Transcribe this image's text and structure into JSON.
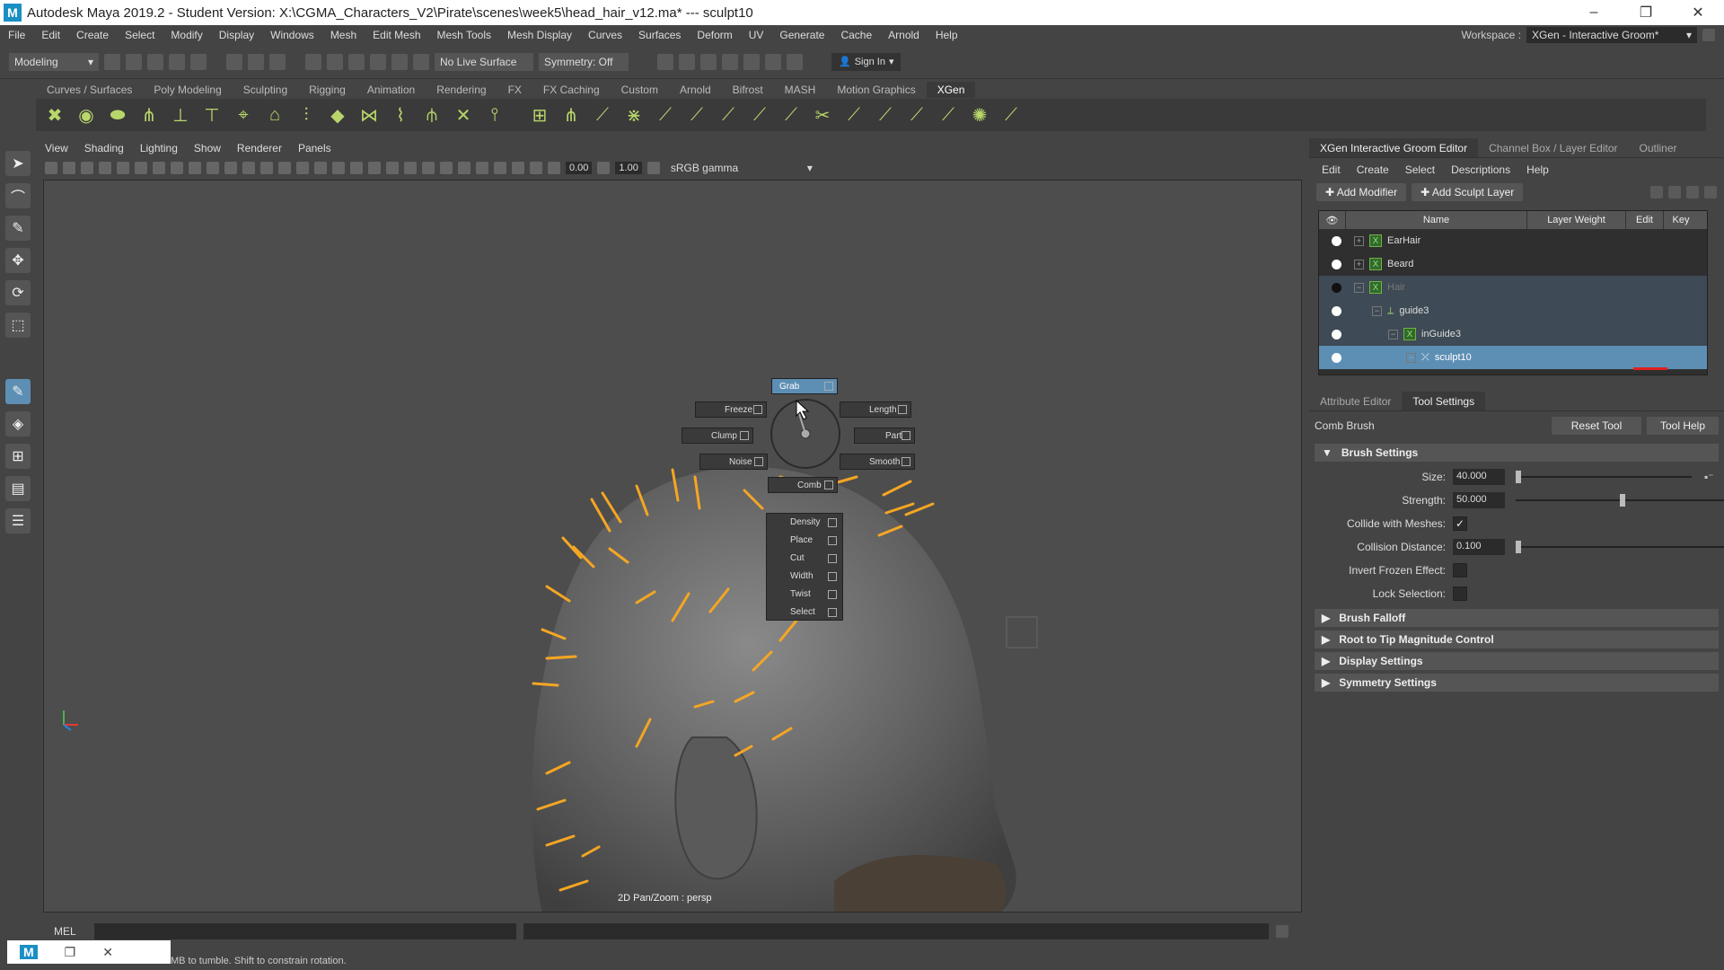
{
  "window": {
    "title": "Autodesk Maya 2019.2 - Student Version: X:\\CGMA_Characters_V2\\Pirate\\scenes\\week5\\head_hair_v12.ma*   ---   sculpt10",
    "logo": "M",
    "minimize": "–",
    "restore": "❐",
    "close": "✕"
  },
  "menubar": {
    "items": [
      "File",
      "Edit",
      "Create",
      "Select",
      "Modify",
      "Display",
      "Windows",
      "Mesh",
      "Edit Mesh",
      "Mesh Tools",
      "Mesh Display",
      "Curves",
      "Surfaces",
      "Deform",
      "UV",
      "Generate",
      "Cache",
      "Arnold",
      "Help"
    ],
    "workspace_label": "Workspace :",
    "workspace_value": "XGen - Interactive Groom*"
  },
  "statusline": {
    "mode": "Modeling",
    "live_surface": "No Live Surface",
    "symmetry": "Symmetry: Off",
    "sign_in": "Sign In"
  },
  "shelf": {
    "tabs": [
      "Curves / Surfaces",
      "Poly Modeling",
      "Sculpting",
      "Rigging",
      "Animation",
      "Rendering",
      "FX",
      "FX Caching",
      "Custom",
      "Arnold",
      "Bifrost",
      "MASH",
      "Motion Graphics",
      "XGen"
    ],
    "active_tab": "XGen"
  },
  "viewport": {
    "menu": [
      "View",
      "Shading",
      "Lighting",
      "Show",
      "Renderer",
      "Panels"
    ],
    "near_value": "0.00",
    "far_value": "1.00",
    "color_space": "sRGB gamma",
    "camera_label": "2D Pan/Zoom : persp"
  },
  "marking_menu": {
    "grab": "Grab",
    "freeze": "Freeze",
    "length": "Length",
    "clump": "Clump",
    "part": "Part",
    "noise": "Noise",
    "smooth": "Smooth",
    "comb": "Comb",
    "list": [
      "Density",
      "Place",
      "Cut",
      "Width",
      "Twist",
      "Select"
    ]
  },
  "cmdline": {
    "label": "MEL"
  },
  "helpline": {
    "text": "MB to tumble. Shift to constrain rotation."
  },
  "right_panel": {
    "tabs": [
      "XGen Interactive Groom Editor",
      "Channel Box / Layer Editor",
      "Outliner"
    ],
    "menu": [
      "Edit",
      "Create",
      "Select",
      "Descriptions",
      "Help"
    ],
    "add_modifier": "Add Modifier",
    "add_sculpt_layer": "Add Sculpt Layer",
    "columns": [
      "Name",
      "Layer Weight",
      "Edit",
      "Key"
    ],
    "rows": [
      {
        "name": "EarHair",
        "indent": 0
      },
      {
        "name": "Beard",
        "indent": 0
      },
      {
        "name": "Hair",
        "indent": 0
      },
      {
        "name": "guide3",
        "indent": 1
      },
      {
        "name": "inGuide3",
        "indent": 2
      },
      {
        "name": "sculpt10",
        "indent": 3
      }
    ],
    "sub_tabs": [
      "Attribute Editor",
      "Tool Settings"
    ],
    "tool_name": "Comb Brush",
    "reset_tool": "Reset Tool",
    "tool_help": "Tool Help",
    "brush_settings": "Brush Settings",
    "size_label": "Size:",
    "size_value": "40.000",
    "strength_label": "Strength:",
    "strength_value": "50.000",
    "collide_label": "Collide with Meshes:",
    "collision_distance_label": "Collision Distance:",
    "collision_distance_value": "0.100",
    "invert_frozen_label": "Invert Frozen Effect:",
    "lock_selection_label": "Lock Selection:",
    "sections": [
      "Brush Falloff",
      "Root to Tip Magnitude Control",
      "Display Settings",
      "Symmetry Settings"
    ],
    "check_mark": "✓"
  }
}
